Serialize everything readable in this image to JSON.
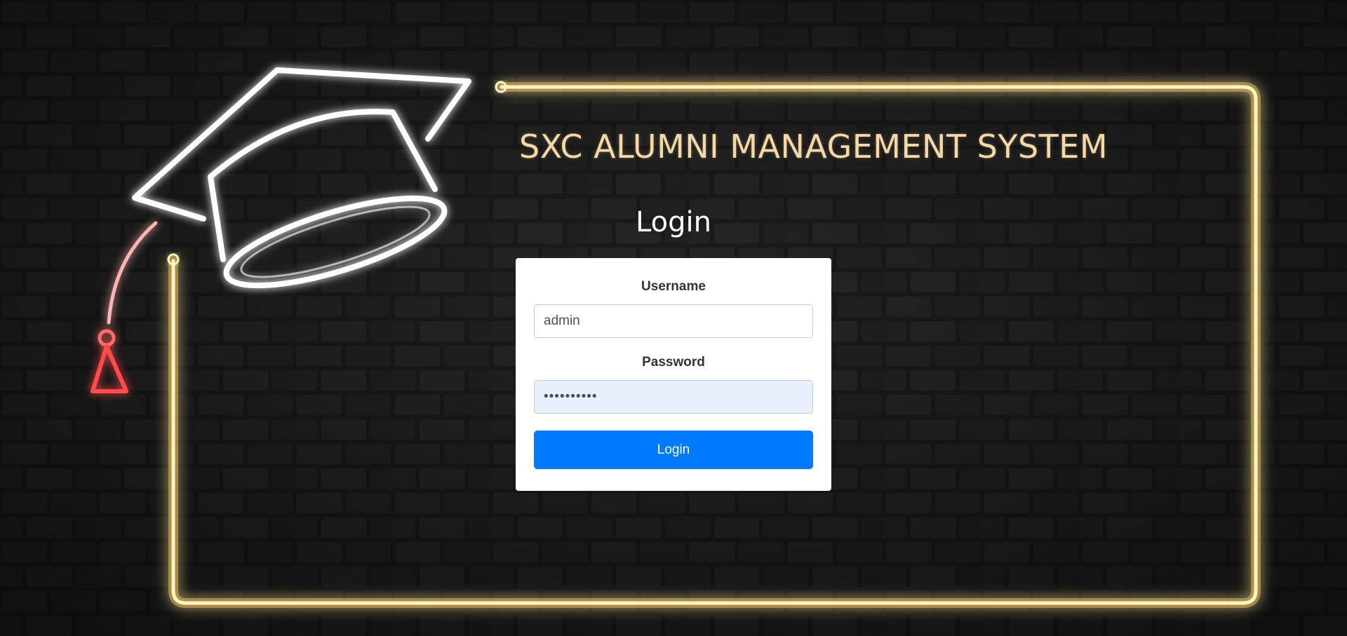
{
  "app": {
    "title": "SXC ALUMNI MANAGEMENT SYSTEM"
  },
  "login": {
    "heading": "Login",
    "username_label": "Username",
    "username_value": "admin",
    "password_label": "Password",
    "password_value": "••••••••••",
    "submit_label": "Login"
  },
  "theme": {
    "neon_frame_color": "#fff2b0",
    "neon_glow_color": "#ffd700",
    "cap_color": "#ffffff",
    "tassel_color": "#ff3b3b",
    "title_color": "#f4d8a8",
    "button_color": "#007bff"
  },
  "icons": {
    "background": "graduation-cap-icon"
  }
}
